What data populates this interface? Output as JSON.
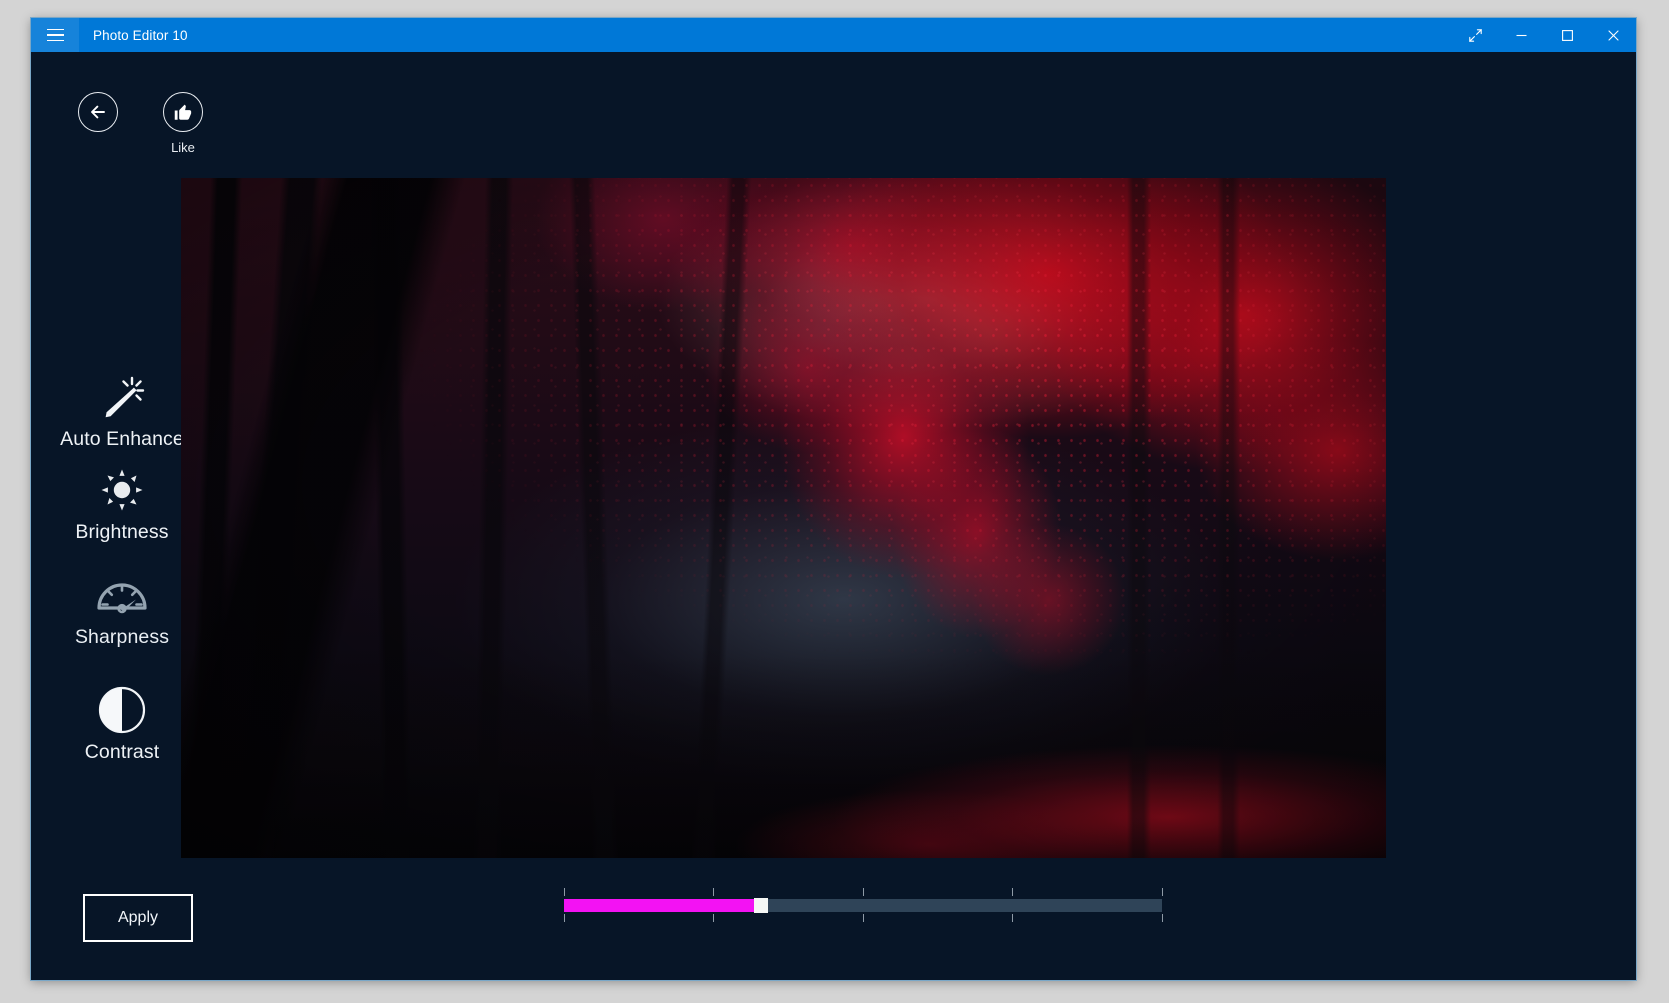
{
  "window": {
    "title": "Photo Editor 10",
    "menu_icon": "hamburger-icon",
    "controls": [
      {
        "name": "restore-down-button",
        "icon": "diagonal-arrows-icon",
        "label": "Restore Down"
      },
      {
        "name": "minimize-button",
        "icon": "minimize-icon",
        "label": "Minimize"
      },
      {
        "name": "maximize-button",
        "icon": "maximize-icon",
        "label": "Maximize"
      },
      {
        "name": "close-button",
        "icon": "close-icon",
        "label": "Close"
      }
    ],
    "titlebar_color": "#0078d7",
    "app_background": "#071527"
  },
  "command_bar": {
    "back": {
      "label": "",
      "icon": "back-arrow-icon"
    },
    "like": {
      "label": "Like",
      "icon": "thumbs-up-icon"
    }
  },
  "sidebar": {
    "tools": [
      {
        "label": "Auto Enhance",
        "icon": "magic-wand-icon",
        "state": "enabled"
      },
      {
        "label": "Brightness",
        "icon": "sun-icon",
        "state": "enabled"
      },
      {
        "label": "Sharpness",
        "icon": "gauge-icon",
        "state": "dimmed"
      },
      {
        "label": "Contrast",
        "icon": "half-circle-icon",
        "state": "enabled"
      }
    ],
    "apply_button": "Apply"
  },
  "photo": {
    "alt": "Dark forest path with vivid red autumn foliage",
    "name": "photo-preview"
  },
  "slider": {
    "name": "adjustment-slider",
    "value_percent": 32,
    "min": 0,
    "max": 100,
    "fill_color": "#f312f3",
    "track_color": "#2f4458",
    "thumb_color": "#f5f7f5",
    "tick_percents": [
      0,
      25,
      50,
      75,
      100
    ]
  }
}
